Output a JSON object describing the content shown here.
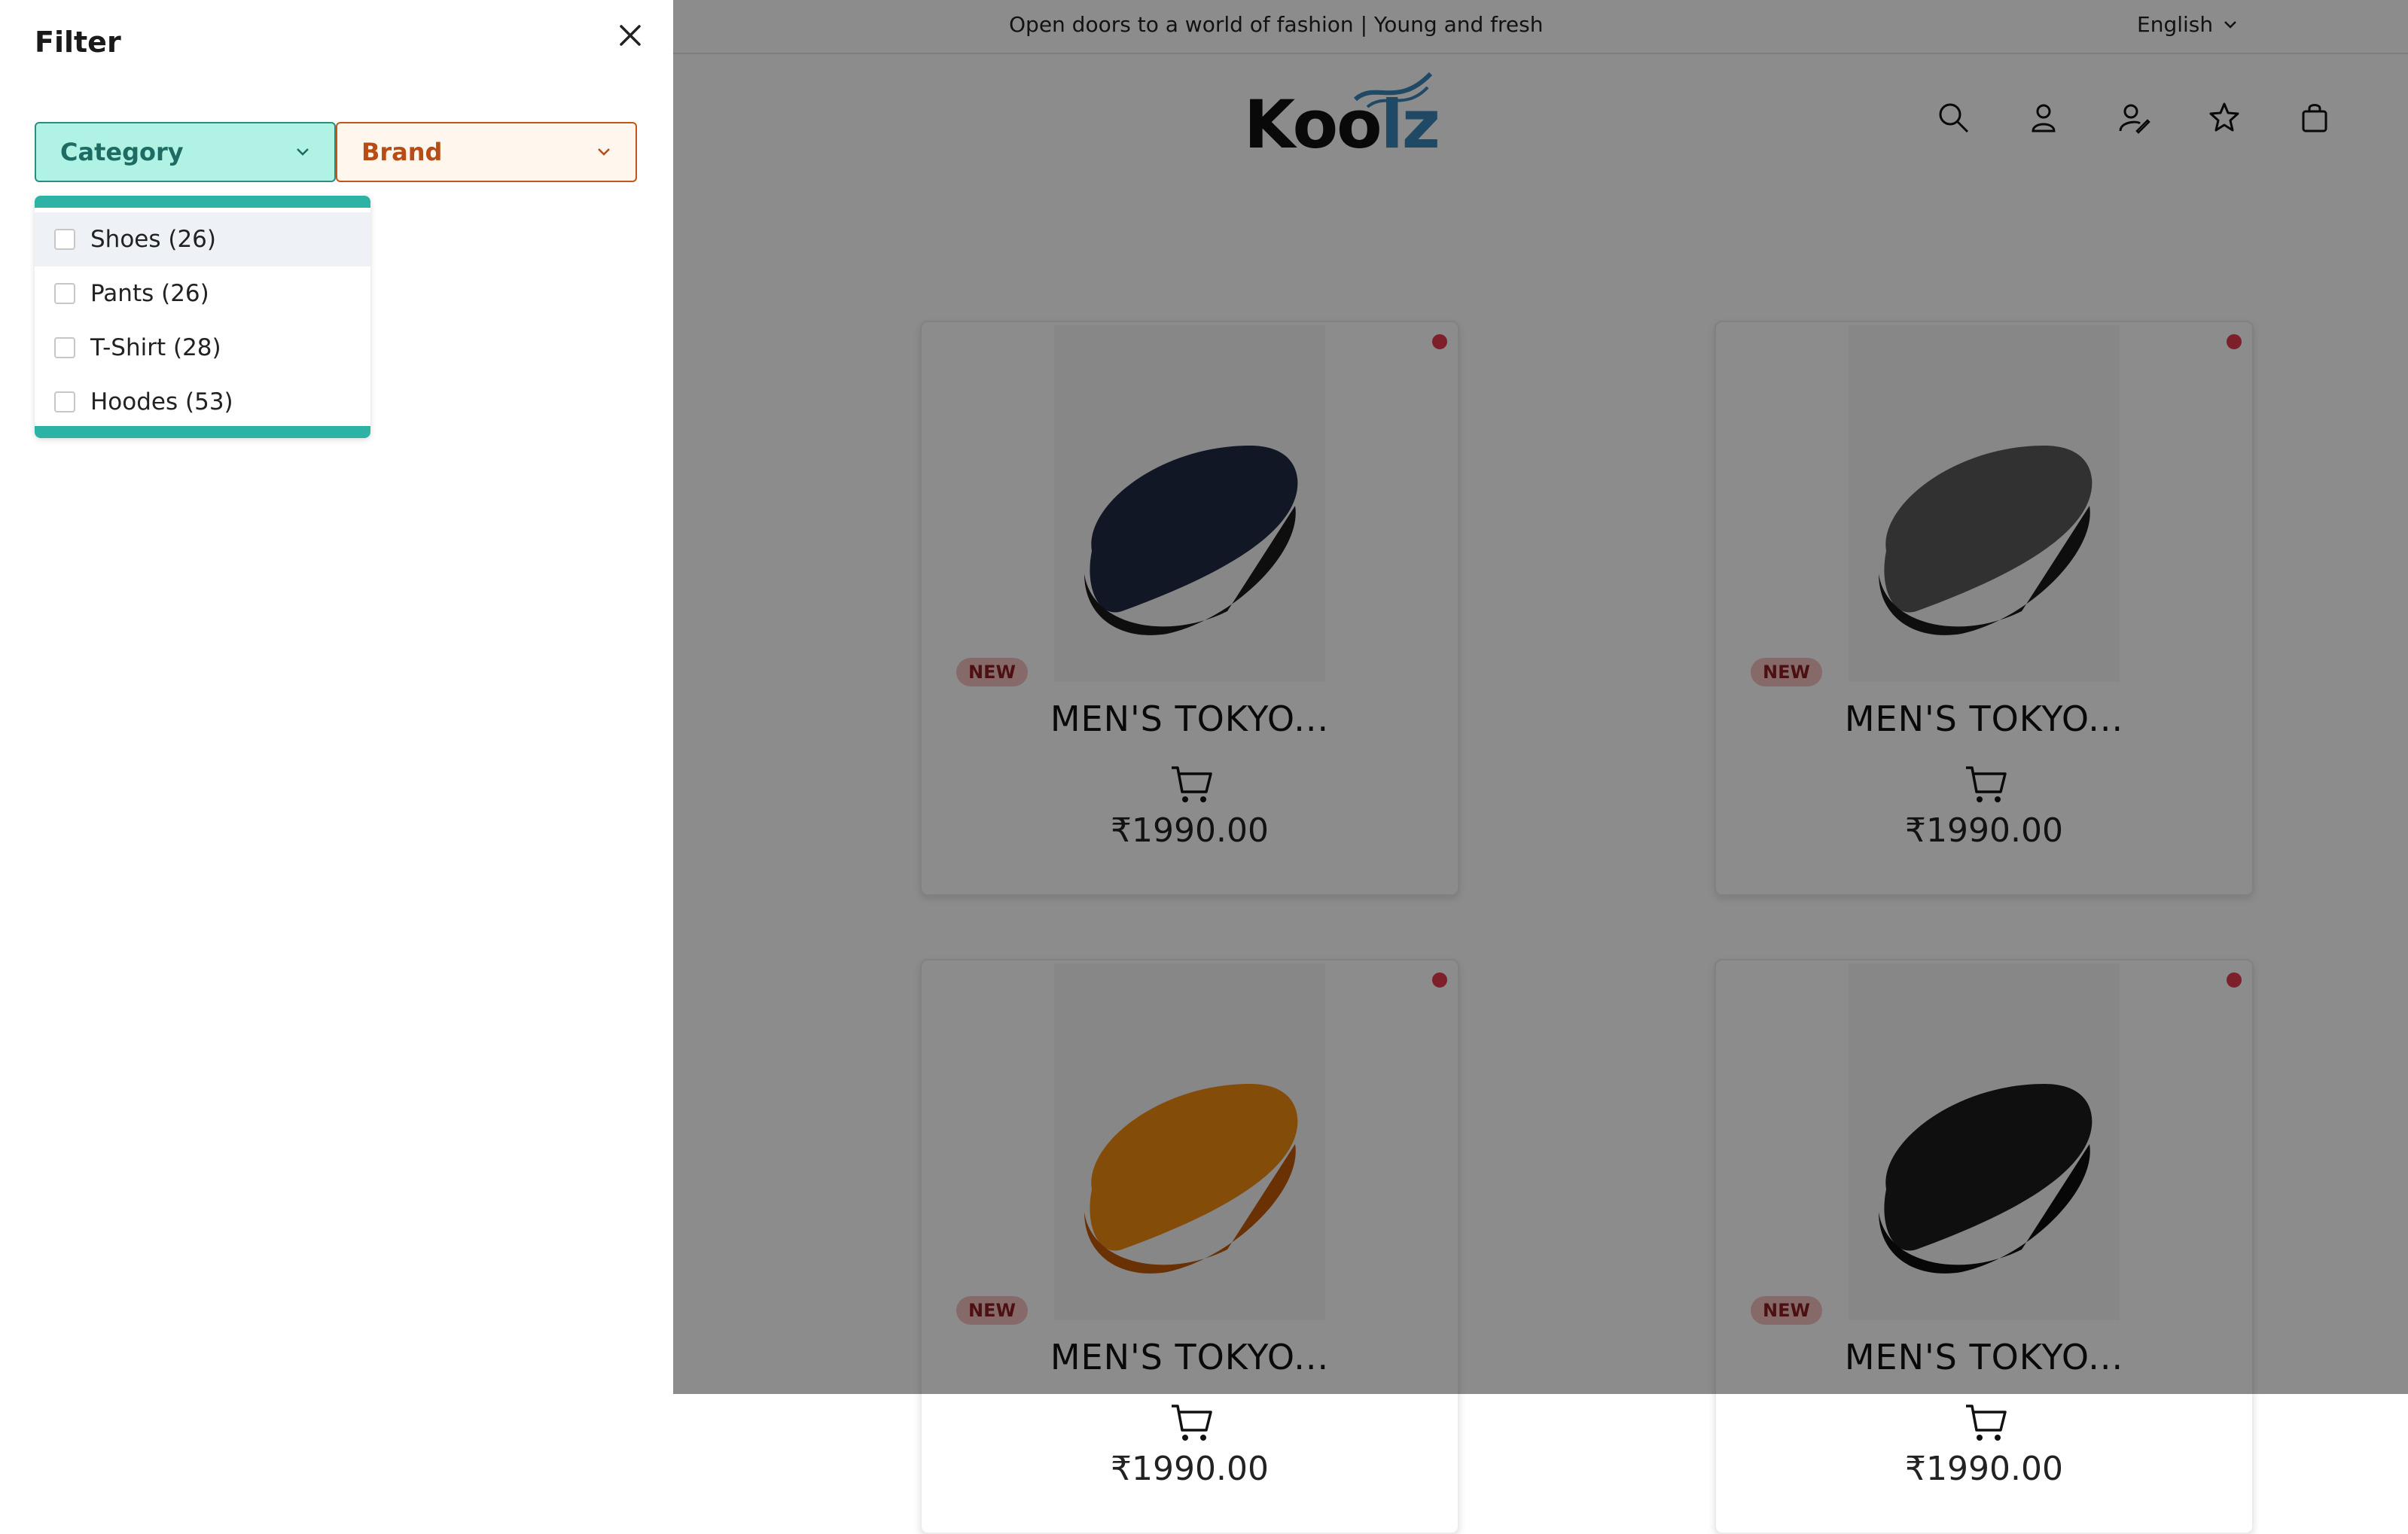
{
  "announcement": "Open doors to a world of fashion | Young and fresh",
  "language": "English",
  "logo": {
    "text_main": "Koo",
    "text_accent": "lz"
  },
  "header_icons": [
    "search-icon",
    "user-icon",
    "user-edit-icon",
    "star-icon",
    "bag-icon"
  ],
  "products": [
    {
      "badge": "NEW",
      "title": "MEN'S TOKYO...",
      "price": "₹1990.00",
      "color": "#1f2a44"
    },
    {
      "badge": "NEW",
      "title": "MEN'S TOKYO...",
      "price": "₹1990.00",
      "color": "#5a5a5a"
    },
    {
      "badge": "NEW",
      "title": "MEN'S TOKYO...",
      "price": "₹1990.00",
      "color": "#f08a12"
    },
    {
      "badge": "NEW",
      "title": "MEN'S TOKYO...",
      "price": "₹1990.00",
      "color": "#1c1c1c"
    }
  ],
  "filter": {
    "title": "Filter",
    "category_label": "Category",
    "brand_label": "Brand",
    "options": [
      {
        "label": "Shoes (26)"
      },
      {
        "label": "Pants (26)"
      },
      {
        "label": "T-Shirt (28)"
      },
      {
        "label": "Hoodes (53)"
      }
    ]
  },
  "colors": {
    "accent_teal": "#2db2a6",
    "brand_orange": "#c0561c",
    "badge_red": "#e53b4c"
  }
}
